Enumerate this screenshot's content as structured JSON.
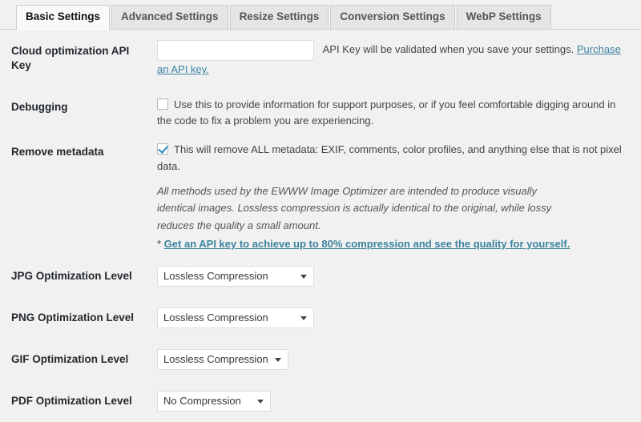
{
  "tabs": [
    {
      "label": "Basic Settings",
      "active": true
    },
    {
      "label": "Advanced Settings",
      "active": false
    },
    {
      "label": "Resize Settings",
      "active": false
    },
    {
      "label": "Conversion Settings",
      "active": false
    },
    {
      "label": "WebP Settings",
      "active": false
    }
  ],
  "rows": {
    "api_key": {
      "label": "Cloud optimization API Key",
      "input_value": "",
      "input_placeholder": "",
      "help_text": "API Key will be validated when you save your settings.",
      "link_text": "Purchase an API key."
    },
    "debugging": {
      "label": "Debugging",
      "checked": false,
      "description": "Use this to provide information for support purposes, or if you feel comfortable digging around in the code to fix a problem you are experiencing."
    },
    "remove_metadata": {
      "label": "Remove metadata",
      "checked": true,
      "description": "This will remove ALL metadata: EXIF, comments, color profiles, and anything else that is not pixel data."
    },
    "note": {
      "italic_text": "All methods used by the EWWW Image Optimizer are intended to produce visually identical images. Lossless compression is actually identical to the original, while lossy reduces the quality a small amount.",
      "asterisk": "*",
      "link_text": "Get an API key to achieve up to 80% compression and see the quality for yourself."
    },
    "jpg": {
      "label": "JPG Optimization Level",
      "value": "Lossless Compression"
    },
    "png": {
      "label": "PNG Optimization Level",
      "value": "Lossless Compression"
    },
    "gif": {
      "label": "GIF Optimization Level",
      "value": "Lossless Compression"
    },
    "pdf": {
      "label": "PDF Optimization Level",
      "value": "No Compression"
    }
  },
  "colors": {
    "link": "#3a83a0",
    "checkbox_check": "#1e8cbe",
    "page_bg": "#f1f1f1",
    "tab_active_bg": "#f9f9f9",
    "tab_inactive_bg": "#e5e5e5"
  }
}
